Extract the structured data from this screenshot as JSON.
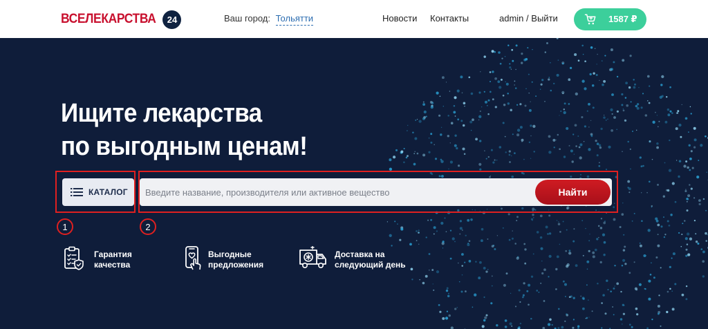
{
  "header": {
    "logo_text": "ВСЕЛЕКАРСТВА",
    "logo_badge": "24",
    "city_label": "Ваш город:",
    "city_name": "Тольятти",
    "nav_news": "Новости",
    "nav_contacts": "Контакты",
    "user_name": "admin",
    "user_separator": "/",
    "logout_label": "Выйти",
    "cart_total": "1587 ₽"
  },
  "hero": {
    "title_line1": "Ищите лекарства",
    "title_line2": "по выгодным ценам!",
    "catalog_label": "КАТАЛОГ",
    "search_placeholder": "Введите название, производителя или активное вещество",
    "search_button": "Найти"
  },
  "annotations": {
    "marker_1": "1",
    "marker_2": "2"
  },
  "features": [
    {
      "line1": "Гарантия",
      "line2": "качества",
      "icon": "clipboard-shield-icon"
    },
    {
      "line1": "Выгодные",
      "line2": "предложения",
      "icon": "phone-heart-icon"
    },
    {
      "line1": "Доставка на",
      "line2": "следующий день",
      "icon": "ambulance-truck-icon"
    }
  ],
  "colors": {
    "brand_red": "#c8102e",
    "hero_bg": "#0f1d3a",
    "cart_green": "#3ccf9b",
    "search_button_red": "#cf1b22",
    "annotation_red": "#e02020"
  }
}
